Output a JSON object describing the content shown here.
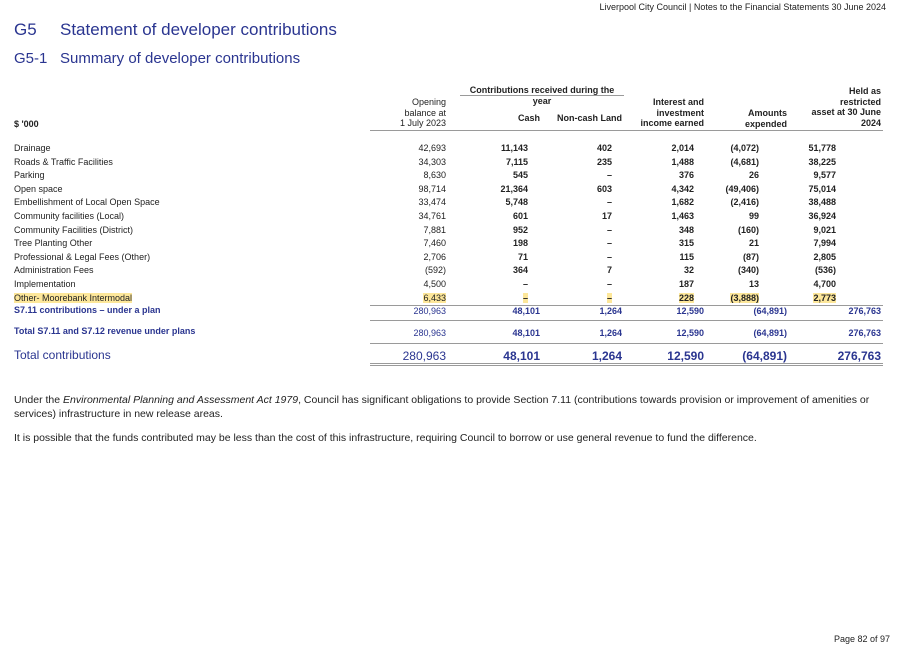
{
  "header": {
    "doc": "Liverpool City Council | Notes to the Financial Statements 30 June 2024"
  },
  "titles": {
    "g5_num": "G5",
    "g5_text": "Statement of developer contributions",
    "g51_num": "G5-1",
    "g51_text": "Summary of developer contributions"
  },
  "columns": {
    "unit": "$ '000",
    "group": "Contributions received during the year",
    "opening": [
      "Opening",
      "balance at",
      "1 July 2023"
    ],
    "cash": "Cash",
    "noncash": "Non-cash Land",
    "interest": [
      "Interest and",
      "investment",
      "income earned"
    ],
    "amounts": [
      "Amounts",
      "expended"
    ],
    "held": [
      "Held as",
      "restricted",
      "asset at 30 June",
      "2024"
    ]
  },
  "rows": [
    {
      "label": "Drainage",
      "opening": "42,693",
      "cash": "11,143",
      "noncash": "402",
      "interest": "2,014",
      "expended": "(4,072)",
      "held": "51,778"
    },
    {
      "label": "Roads & Traffic Facilities",
      "opening": "34,303",
      "cash": "7,115",
      "noncash": "235",
      "interest": "1,488",
      "expended": "(4,681)",
      "held": "38,225"
    },
    {
      "label": "Parking",
      "opening": "8,630",
      "cash": "545",
      "noncash": "–",
      "interest": "376",
      "expended": "26",
      "held": "9,577"
    },
    {
      "label": "Open space",
      "opening": "98,714",
      "cash": "21,364",
      "noncash": "603",
      "interest": "4,342",
      "expended": "(49,406)",
      "held": "75,014"
    },
    {
      "label": "Embellishment of Local Open Space",
      "opening": "33,474",
      "cash": "5,748",
      "noncash": "–",
      "interest": "1,682",
      "expended": "(2,416)",
      "held": "38,488"
    },
    {
      "label": "Community facilities (Local)",
      "opening": "34,761",
      "cash": "601",
      "noncash": "17",
      "interest": "1,463",
      "expended": "99",
      "held": "36,924"
    },
    {
      "label": "Community Facilities (District)",
      "opening": "7,881",
      "cash": "952",
      "noncash": "–",
      "interest": "348",
      "expended": "(160)",
      "held": "9,021"
    },
    {
      "label": "Tree Planting Other",
      "opening": "7,460",
      "cash": "198",
      "noncash": "–",
      "interest": "315",
      "expended": "21",
      "held": "7,994"
    },
    {
      "label": "Professional & Legal Fees (Other)",
      "opening": "2,706",
      "cash": "71",
      "noncash": "–",
      "interest": "115",
      "expended": "(87)",
      "held": "2,805"
    },
    {
      "label": "Administration Fees",
      "opening": "(592)",
      "cash": "364",
      "noncash": "7",
      "interest": "32",
      "expended": "(340)",
      "held": "(536)"
    },
    {
      "label": "Implementation",
      "opening": "4,500",
      "cash": "–",
      "noncash": "–",
      "interest": "187",
      "expended": "13",
      "held": "4,700"
    },
    {
      "label": "Other- Moorebank Intermodal",
      "opening": "6,433",
      "cash": "–",
      "noncash": "–",
      "interest": "228",
      "expended": "(3,888)",
      "held": "2,773"
    }
  ],
  "subtotal": {
    "label": "S7.11 contributions – under a plan",
    "opening": "280,963",
    "cash": "48,101",
    "noncash": "1,264",
    "interest": "12,590",
    "expended": "(64,891)",
    "held": "276,763"
  },
  "total_plans": {
    "label": "Total S7.11 and S7.12 revenue under plans",
    "opening": "280,963",
    "cash": "48,101",
    "noncash": "1,264",
    "interest": "12,590",
    "expended": "(64,891)",
    "held": "276,763"
  },
  "total": {
    "label": "Total contributions",
    "opening": "280,963",
    "cash": "48,101",
    "noncash": "1,264",
    "interest": "12,590",
    "expended": "(64,891)",
    "held": "276,763"
  },
  "paragraphs": {
    "p1_a": "Under the ",
    "p1_italic": "Environmental Planning and Assessment Act 1979",
    "p1_b": ", Council has significant obligations to provide Section 7.11 (contributions towards provision or improvement of amenities or services) infrastructure in new release areas.",
    "p2": "It is possible that the funds contributed may be less than the cost of this infrastructure, requiring Council to borrow or use general revenue to fund the difference."
  },
  "footer": {
    "page": "Page 82 of 97"
  }
}
